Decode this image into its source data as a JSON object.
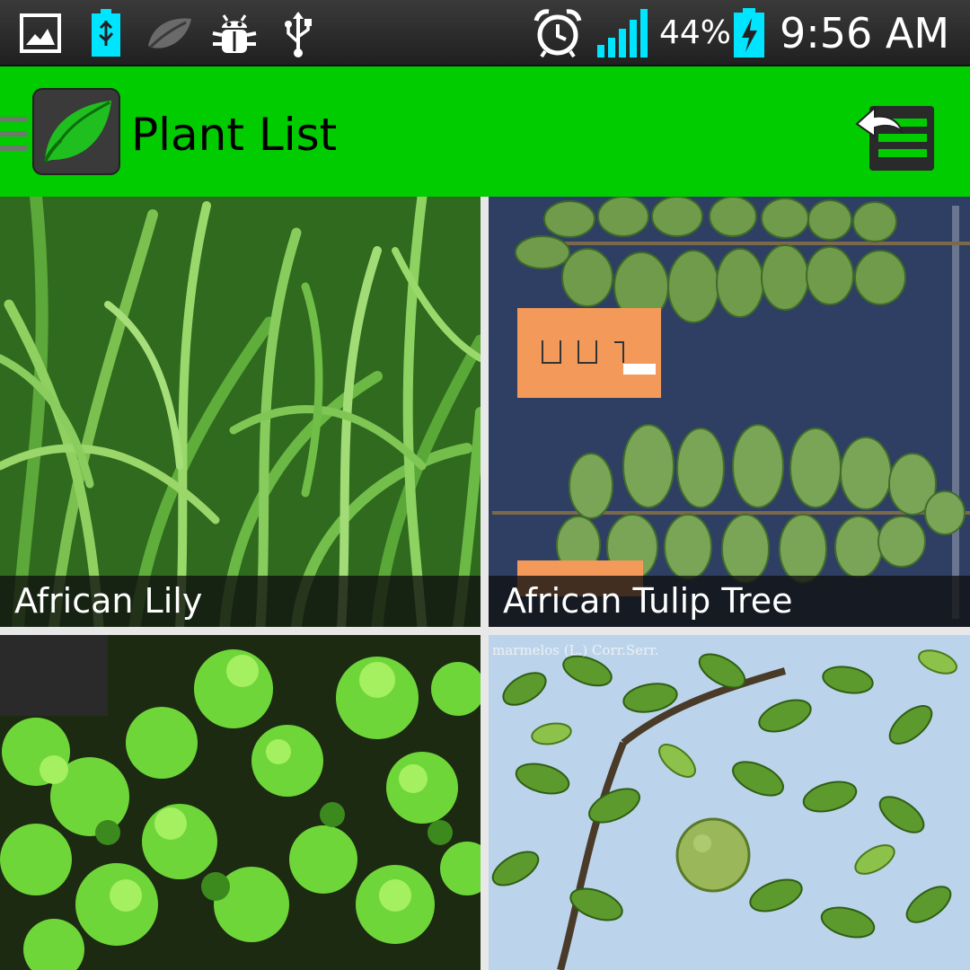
{
  "status_bar": {
    "battery_percent": "44%",
    "time": "9:56 AM",
    "icons": [
      "gallery-icon",
      "usb-battery-icon",
      "leaf-icon",
      "android-debug-icon",
      "usb-icon",
      "alarm-clock-icon",
      "signal-icon",
      "charging-battery-icon"
    ]
  },
  "action_bar": {
    "title": "Plant List",
    "background_color": "#00cc00",
    "app_icon": "leaf-icon",
    "action_icon": "list-return-icon"
  },
  "plants": [
    {
      "name": "African Lily",
      "photo": "grass-blades"
    },
    {
      "name": "African Tulip Tree",
      "photo": "pressed-leaves-herbarium"
    },
    {
      "name": "",
      "photo": "moss-foliage"
    },
    {
      "name": "",
      "photo": "bael-fruit-tree",
      "overlay_text": "marmelos (L.) Corr.Serr."
    }
  ]
}
